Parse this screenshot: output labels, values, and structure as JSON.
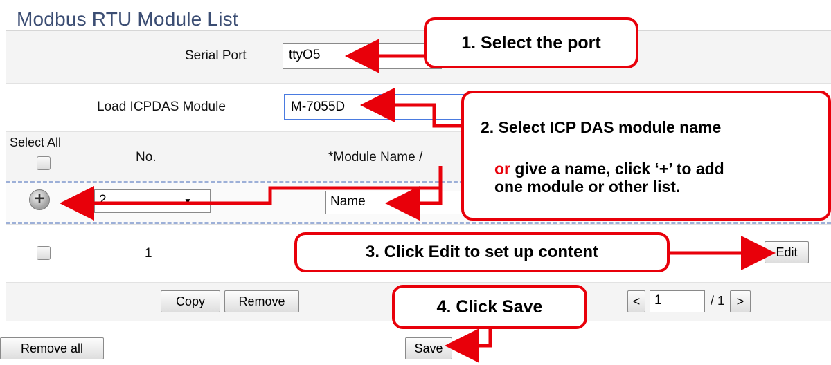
{
  "title": "Modbus RTU Module List",
  "serial_port": {
    "label": "Serial Port",
    "value": "ttyO5"
  },
  "load_module": {
    "label": "Load ICPDAS Module",
    "value": "M-7055D"
  },
  "table": {
    "select_all_label": "Select All",
    "col_no": "No.",
    "col_module_name": "*Module Name /"
  },
  "add_row": {
    "no_select_value": "2",
    "name_value": "Name"
  },
  "data_row": {
    "no": "1",
    "edit_label": "Edit"
  },
  "actions": {
    "copy_label": "Copy",
    "remove_label": "Remove",
    "remove_all_label": "Remove all",
    "save_label": "Save"
  },
  "pagination": {
    "prev_label": "<",
    "page_value": "1",
    "total_label": "/ 1",
    "next_label": ">"
  },
  "callouts": {
    "c1": "1.  Select the port",
    "c2_line1": "2. Select ICP DAS module name",
    "c2_or": "or",
    "c2_line2": " give a name, click ‘+’ to add",
    "c2_line3": "one module or other list.",
    "c3": "3. Click Edit to set up content",
    "c4": "4. Click Save"
  },
  "colors": {
    "callout_red": "#e8000a",
    "title_blue": "#3b4d73",
    "dash_blue": "#9db0d8"
  }
}
